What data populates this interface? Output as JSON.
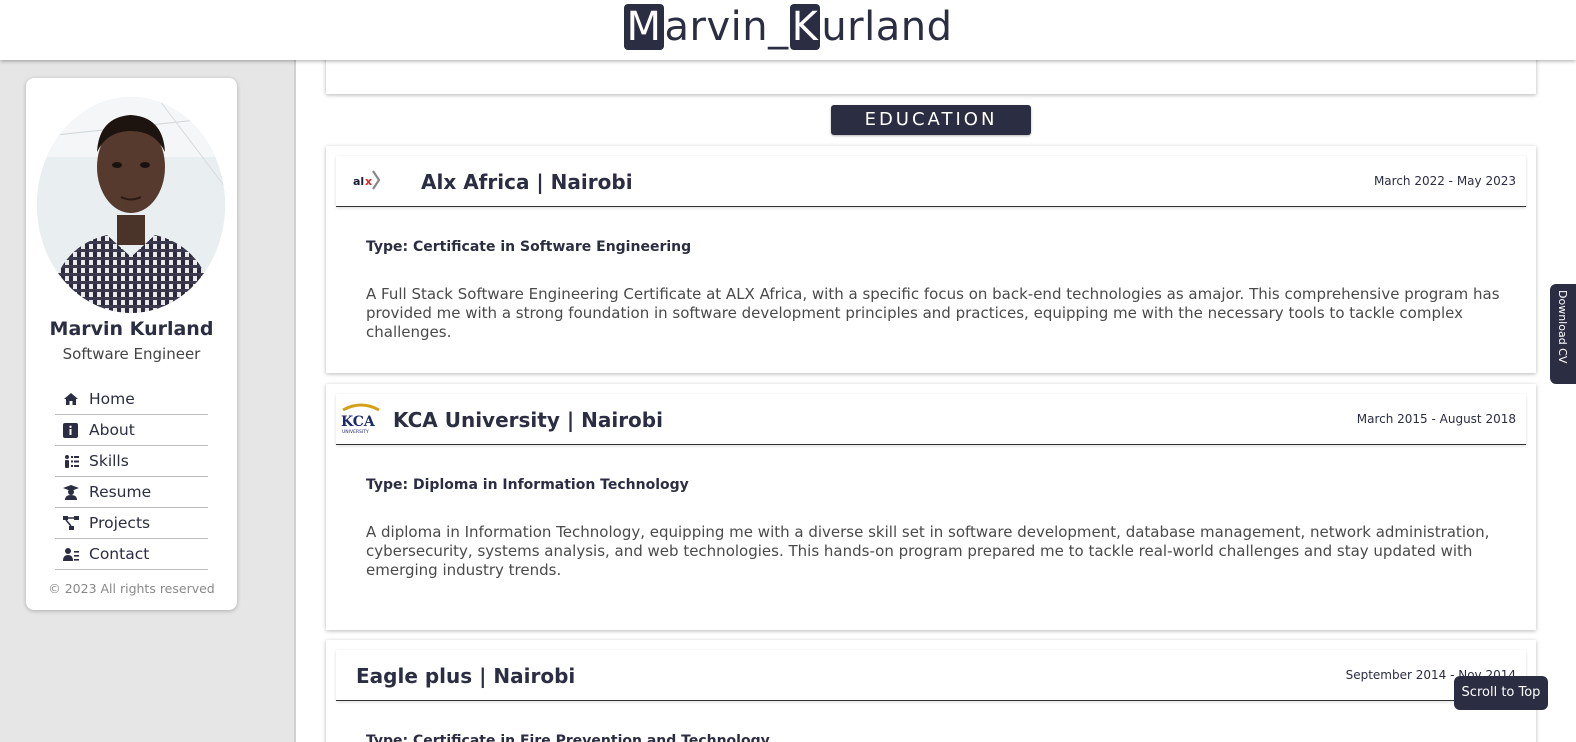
{
  "header": {
    "logo_prefix_box": "M",
    "logo_part1": "arvin_",
    "logo_mid_box": "K",
    "logo_part2": "urland"
  },
  "profile": {
    "name": "Marvin Kurland",
    "role": "Software Engineer",
    "copyright": "© 2023 All rights reserved"
  },
  "nav": {
    "items": [
      {
        "label": "Home",
        "icon": "home-icon"
      },
      {
        "label": "About",
        "icon": "info-icon"
      },
      {
        "label": "Skills",
        "icon": "skills-icon"
      },
      {
        "label": "Resume",
        "icon": "graduate-icon"
      },
      {
        "label": "Projects",
        "icon": "diagram-icon"
      },
      {
        "label": "Contact",
        "icon": "contact-card-icon"
      }
    ]
  },
  "education": {
    "title": "EDUCATION",
    "entries": [
      {
        "institution": "Alx Africa | Nairobi",
        "logo_text": "alx",
        "dates": "March 2022 - May 2023",
        "type": "Type: Certificate in Software Engineering",
        "description": "A Full Stack Software Engineering Certificate at ALX Africa, with a specific focus on back-end technologies as amajor. This comprehensive program has provided me with a strong foundation in software development principles and practices, equipping me with the necessary tools to tackle complex challenges."
      },
      {
        "institution": "KCA University | Nairobi",
        "logo_text": "KCA",
        "logo_subtext": "UNIVERSITY",
        "dates": "March 2015 - August 2018",
        "type": "Type: Diploma in Information Technology",
        "description": "A diploma in Information Technology, equipping me with a diverse skill set in software development, database management, network administration, cybersecurity, systems analysis, and web technologies. This hands-on program prepared me to tackle real-world challenges and stay updated with emerging industry trends."
      },
      {
        "institution": "Eagle plus | Nairobi",
        "dates": "September 2014 - Nov 2014",
        "type": "Type: Certificate in Fire Prevention and Technology"
      }
    ]
  },
  "floating": {
    "download_label": "Download CV",
    "scroll_top_label": "Scroll to Top"
  },
  "colors": {
    "primary": "#2b2d42",
    "background": "#e6e6e6",
    "card": "#ffffff"
  }
}
